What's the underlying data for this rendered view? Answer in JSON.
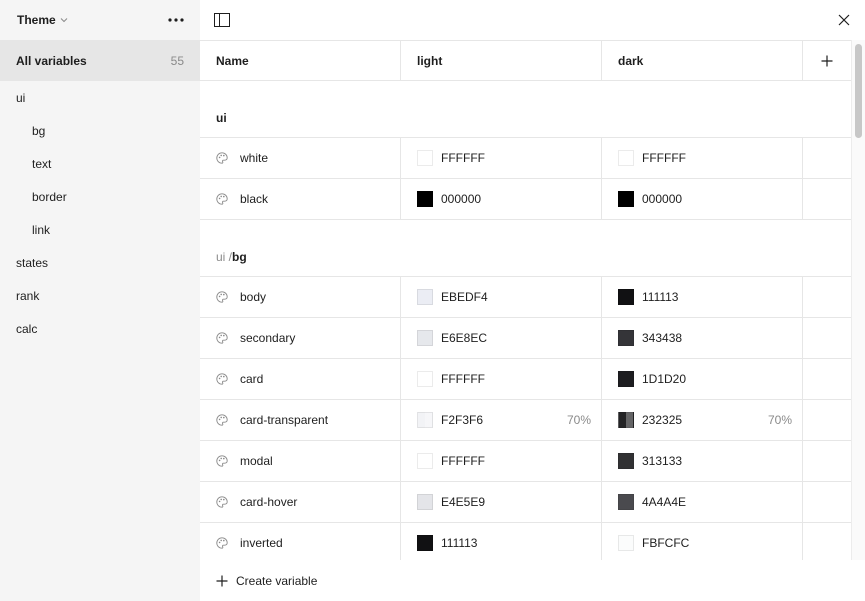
{
  "sidebar": {
    "title": "Theme",
    "all": {
      "label": "All variables",
      "count": "55"
    },
    "groups": [
      {
        "label": "ui"
      },
      {
        "label": "bg"
      },
      {
        "label": "text"
      },
      {
        "label": "border"
      },
      {
        "label": "link"
      },
      {
        "label": "states"
      },
      {
        "label": "rank"
      },
      {
        "label": "calc"
      }
    ]
  },
  "table": {
    "columns": {
      "name": "Name",
      "light": "light",
      "dark": "dark"
    },
    "sections": [
      {
        "path": "",
        "leaf": "ui",
        "rows": [
          {
            "name": "white",
            "light": {
              "hex": "FFFFFF",
              "color": "#FFFFFF"
            },
            "dark": {
              "hex": "FFFFFF",
              "color": "#FFFFFF"
            }
          },
          {
            "name": "black",
            "light": {
              "hex": "000000",
              "color": "#000000"
            },
            "dark": {
              "hex": "000000",
              "color": "#000000"
            }
          }
        ]
      },
      {
        "path": "ui / ",
        "leaf": "bg",
        "rows": [
          {
            "name": "body",
            "light": {
              "hex": "EBEDF4",
              "color": "#EBEDF4"
            },
            "dark": {
              "hex": "111113",
              "color": "#111113"
            }
          },
          {
            "name": "secondary",
            "light": {
              "hex": "E6E8EC",
              "color": "#E6E8EC"
            },
            "dark": {
              "hex": "343438",
              "color": "#343438"
            }
          },
          {
            "name": "card",
            "light": {
              "hex": "FFFFFF",
              "color": "#FFFFFF"
            },
            "dark": {
              "hex": "1D1D20",
              "color": "#1D1D20"
            }
          },
          {
            "name": "card-transparent",
            "light": {
              "hex": "F2F3F6",
              "color": "#F2F3F6",
              "alpha": "70%"
            },
            "dark": {
              "hex": "232325",
              "color": "#232325",
              "alpha": "70%"
            }
          },
          {
            "name": "modal",
            "light": {
              "hex": "FFFFFF",
              "color": "#FFFFFF"
            },
            "dark": {
              "hex": "313133",
              "color": "#313133"
            }
          },
          {
            "name": "card-hover",
            "light": {
              "hex": "E4E5E9",
              "color": "#E4E5E9"
            },
            "dark": {
              "hex": "4A4A4E",
              "color": "#4A4A4E"
            }
          },
          {
            "name": "inverted",
            "light": {
              "hex": "111113",
              "color": "#111113"
            },
            "dark": {
              "hex": "FBFCFC",
              "color": "#FBFCFC"
            }
          }
        ]
      }
    ]
  },
  "footer": {
    "create_label": "Create variable"
  },
  "icons": {
    "variable": "palette-icon",
    "add": "plus-icon",
    "close": "close-icon",
    "sidebar_toggle": "sidebar-toggle-icon",
    "more": "more-icon"
  }
}
